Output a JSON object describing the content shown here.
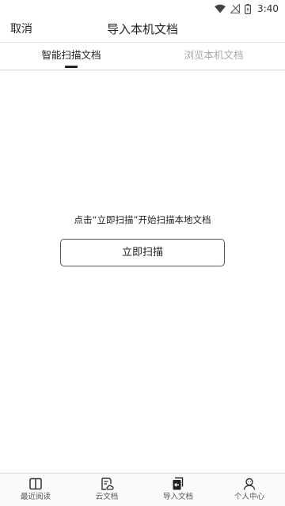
{
  "status_bar": {
    "time": "3:40"
  },
  "app_bar": {
    "cancel_label": "取消",
    "title": "导入本机文档"
  },
  "tabs": [
    {
      "label": "智能扫描文档",
      "active": true
    },
    {
      "label": "浏览本机文档",
      "active": false
    }
  ],
  "main": {
    "hint": "点击“立即扫描”开始扫描本地文档",
    "scan_button_label": "立即扫描"
  },
  "bottom_nav": [
    {
      "label": "最近阅读",
      "icon": "book-icon"
    },
    {
      "label": "云文档",
      "icon": "cloud-doc-icon"
    },
    {
      "label": "导入文档",
      "icon": "import-doc-icon"
    },
    {
      "label": "个人中心",
      "icon": "person-icon"
    }
  ],
  "colors": {
    "accent": "#222222",
    "inactive_tab": "#a8a8a8",
    "divider": "#d6d6d6"
  }
}
